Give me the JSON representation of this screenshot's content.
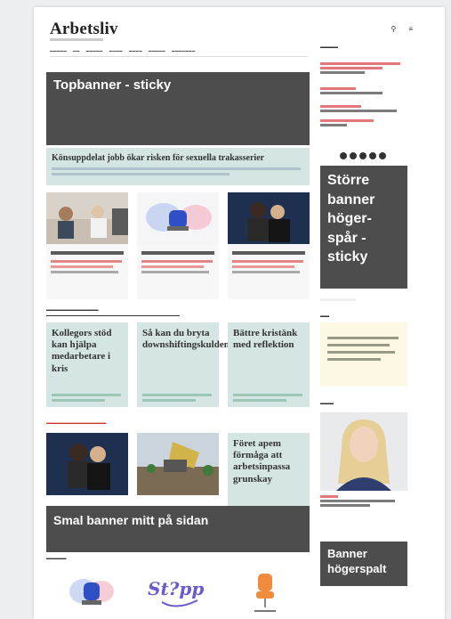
{
  "site": {
    "logo": "Arbetsliv"
  },
  "banners": {
    "top": "Topbanner - sticky",
    "right_sticky": "Större banner höger-spår - sticky",
    "middle": "Smal banner mitt på sidan",
    "side": "Banner högerspalt"
  },
  "hero": {
    "title": "Könsuppdelat jobb ökar risken för sexuella trakasserier"
  },
  "teal_cards": [
    {
      "title": "Kollegors stöd kan hjälpa medarbetare i kris"
    },
    {
      "title": "Så kan du bryta downshiftingskulden"
    },
    {
      "title": "Bättre kristänk med reflektion"
    },
    {
      "title": "Föret apem förmåga att arbetsinpassa grunskay"
    }
  ],
  "colors": {
    "banner": "#4d4d4d",
    "teal": "#d4e5e3",
    "accent_red": "#cc3333",
    "quote_bg": "#fdf8e3"
  }
}
